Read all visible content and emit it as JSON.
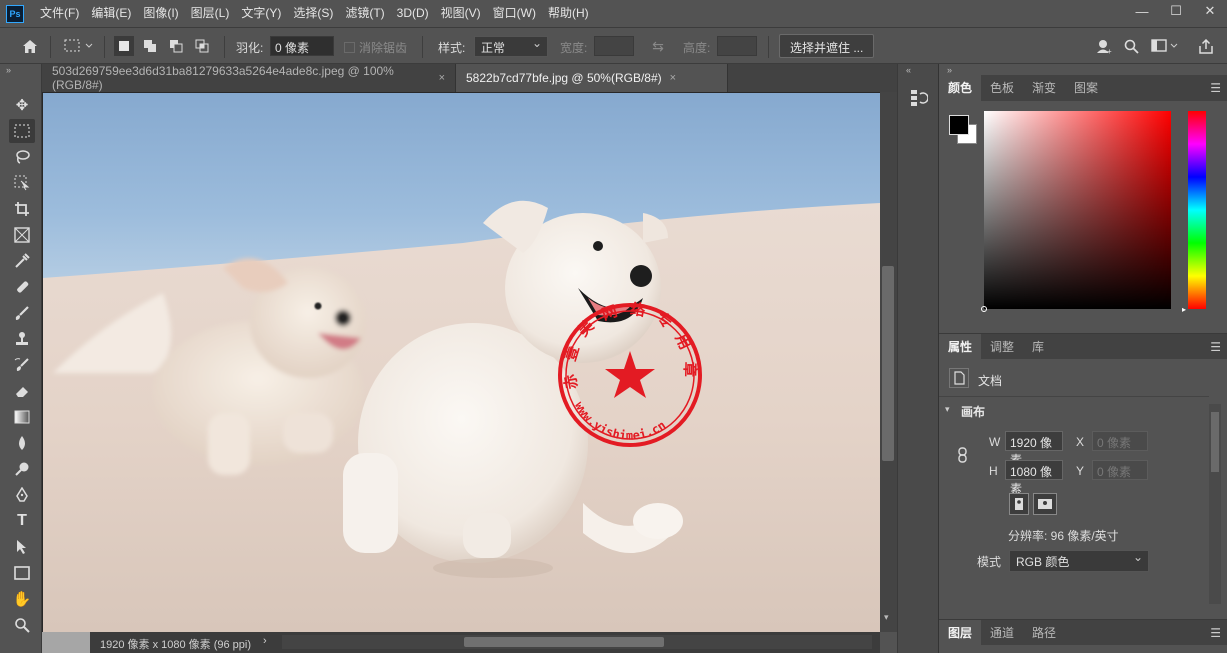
{
  "app": {
    "logo": "Ps"
  },
  "menu": [
    "文件(F)",
    "编辑(E)",
    "图像(I)",
    "图层(L)",
    "文字(Y)",
    "选择(S)",
    "滤镜(T)",
    "3D(D)",
    "视图(V)",
    "窗口(W)",
    "帮助(H)"
  ],
  "window_controls": {
    "minimize": "—",
    "restore": "☐",
    "close": "✕"
  },
  "options": {
    "feather_label": "羽化:",
    "feather_value": "0 像素",
    "antialias_label": "消除锯齿",
    "style_label": "样式:",
    "style_value": "正常",
    "width_label": "宽度:",
    "height_label": "高度:",
    "select_mask_button": "选择并遮住 ..."
  },
  "tabs": [
    {
      "label": "503d269759ee3d6d31ba81279633a5264e4ade8c.jpeg @ 100%(RGB/8#)"
    },
    {
      "label": "5822b7cd77bfe.jpg @ 50%(RGB/8#)"
    }
  ],
  "tab_close": "×",
  "canvas": {
    "stamp_text": "赤 壹 美 网 络 专 用 章",
    "stamp_url": "www.yishimei.cn",
    "colors": {
      "sky": "#8fb3d6",
      "sand": "#e6d8cf",
      "stamp": "#e31b23"
    }
  },
  "status": {
    "doc_size": "1920 像素 x 1080 像素 (96 ppi)",
    "arrow": "›"
  },
  "color_panel": {
    "tabs": [
      "颜色",
      "色板",
      "渐变",
      "图案"
    ],
    "foreground": "#000000",
    "background": "#ffffff",
    "hue": "#ff0000"
  },
  "properties_panel": {
    "tabs": [
      "属性",
      "调整",
      "库"
    ],
    "doc_label": "文档",
    "section": "画布",
    "w_label": "W",
    "w_value": "1920 像素",
    "h_label": "H",
    "h_value": "1080 像素",
    "x_label": "X",
    "x_value": "0 像素",
    "y_label": "Y",
    "y_value": "0 像素",
    "resolution": "分辨率: 96 像素/英寸",
    "mode_label": "模式",
    "mode_value": "RGB 颜色"
  },
  "layers_panel": {
    "tabs": [
      "图层",
      "通道",
      "路径"
    ]
  }
}
